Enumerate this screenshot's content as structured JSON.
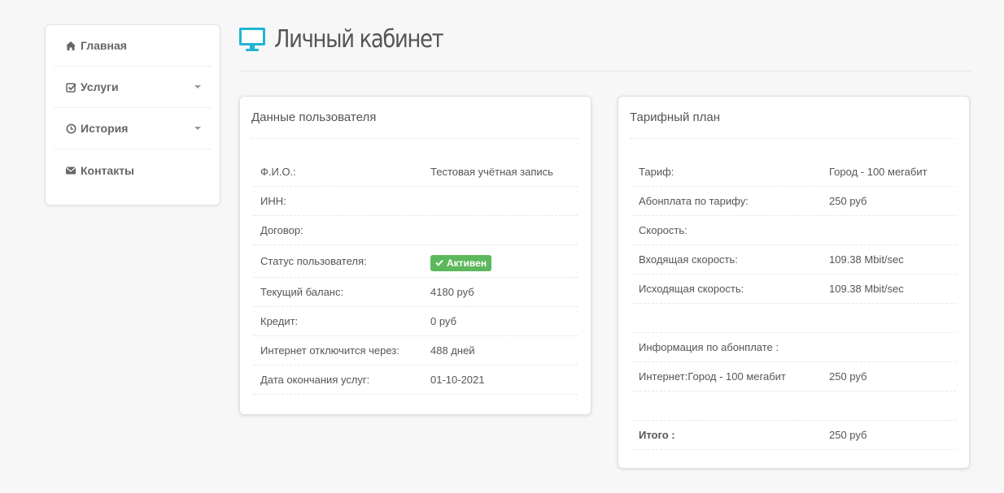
{
  "sidebar": {
    "items": [
      {
        "label": "Главная",
        "icon": "home-icon"
      },
      {
        "label": "Услуги",
        "icon": "check-square-icon"
      },
      {
        "label": "История",
        "icon": "clock-icon"
      },
      {
        "label": "Контакты",
        "icon": "envelope-icon"
      }
    ]
  },
  "header": {
    "title": "Личный кабинет",
    "icon": "monitor-icon",
    "icon_color": "#1fb5d3"
  },
  "user_panel": {
    "title": "Данные пользователя",
    "rows": [
      {
        "label": "Ф.И.О.:",
        "value": "Тестовая учётная запись"
      },
      {
        "label": "ИНН:",
        "value": ""
      },
      {
        "label": "Договор:",
        "value": ""
      },
      {
        "label": "Статус пользователя:",
        "value": "Активен"
      },
      {
        "label": "Текущий баланс:",
        "value": "4180 руб"
      },
      {
        "label": "Кредит:",
        "value": "0 руб"
      },
      {
        "label": "Интернет отключится через:",
        "value": "488 дней"
      },
      {
        "label": "Дата окончания услуг:",
        "value": "01-10-2021"
      }
    ],
    "status_color": "#5cb85c"
  },
  "tariff_panel": {
    "title": "Тарифный план",
    "rows": [
      {
        "label": "Тариф:",
        "value": "Город - 100 мегабит"
      },
      {
        "label": "Абонплата по тарифу:",
        "value": "250 руб"
      },
      {
        "label": "Скорость:",
        "value": ""
      },
      {
        "label": "Входящая скорость:",
        "value": "109.38 Mbit/sec"
      },
      {
        "label": "Исходящая скорость:",
        "value": "109.38 Mbit/sec"
      },
      {
        "label": "",
        "value": ""
      },
      {
        "label": "Информация по абонплате :",
        "value": ""
      },
      {
        "label": "Интернет:Город - 100 мегабит",
        "value": "250 руб"
      },
      {
        "label": "",
        "value": ""
      },
      {
        "label": "Итого :",
        "value": "250 руб"
      }
    ]
  }
}
